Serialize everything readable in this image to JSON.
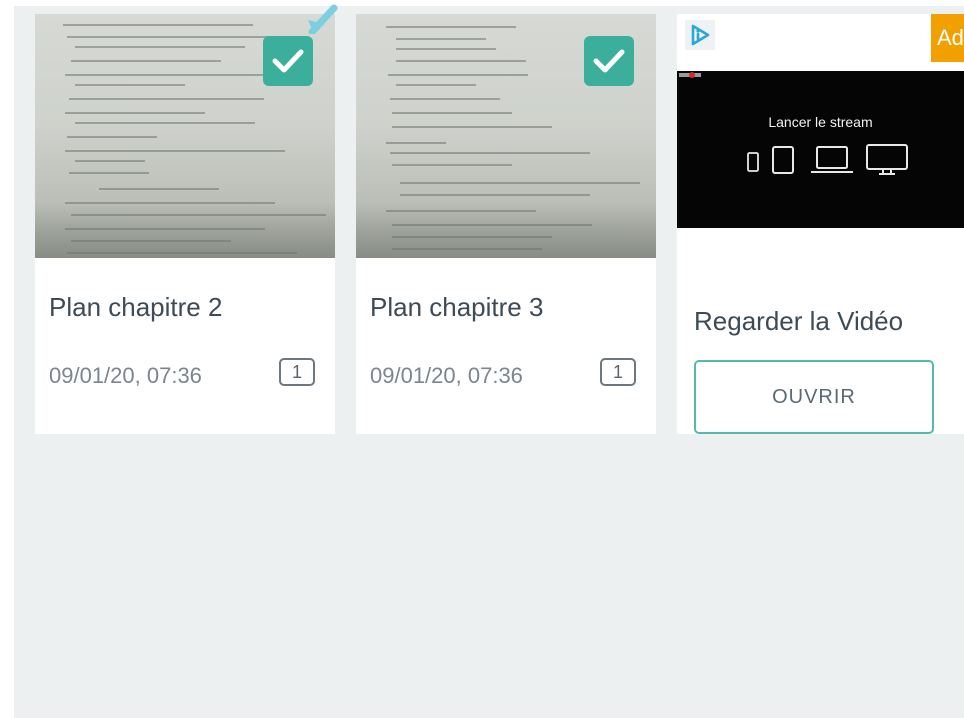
{
  "cards": [
    {
      "title": "Plan chapitre 2",
      "date": "09/01/20, 07:36",
      "pages": "1",
      "selected": true
    },
    {
      "title": "Plan chapitre 3",
      "date": "09/01/20, 07:36",
      "pages": "1",
      "selected": true
    }
  ],
  "ad": {
    "badge": "Ad",
    "video_title": "Lancer le stream",
    "heading": "Regarder la Vidéo",
    "button_label": "OUVRIR",
    "icons": [
      "phone-icon",
      "tablet-icon",
      "laptop-icon",
      "monitor-icon"
    ]
  },
  "colors": {
    "accent": "#3cae9c",
    "ad_badge": "#f2a000",
    "background": "#edf0f1"
  }
}
